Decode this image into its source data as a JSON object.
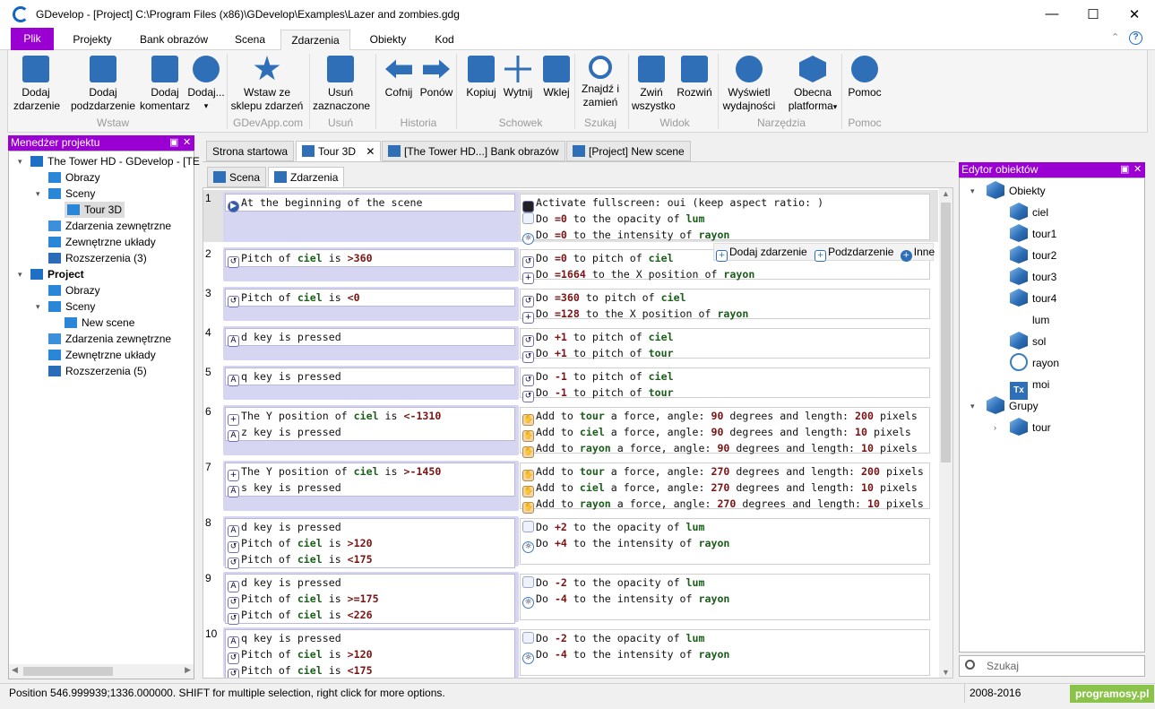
{
  "window": {
    "title": "GDevelop - [Project] C:\\Program Files (x86)\\GDevelop\\Examples\\Lazer and zombies.gdg"
  },
  "window_controls": {
    "min": "—",
    "max": "☐",
    "close": "✕"
  },
  "ribbon_tabs": [
    "Plik",
    "Projekty",
    "Bank obrazów",
    "Scena",
    "Zdarzenia",
    "Obiekty",
    "Kod"
  ],
  "ribbon_right": {
    "collapse": "⌃",
    "help": "?"
  },
  "ribbon": {
    "buttons": [
      {
        "label": "Dodaj\nzdarzenie",
        "icon": "add-event-icon"
      },
      {
        "label": "Dodaj\npodzdarzenie",
        "icon": "add-subevent-icon"
      },
      {
        "label": "Dodaj\nkomentarz",
        "icon": "add-comment-icon"
      },
      {
        "label": "Dodaj...",
        "icon": "add-more-icon"
      },
      {
        "label": "Wstaw ze\nsklepu zdarzeń",
        "icon": "event-store-icon"
      },
      {
        "label": "Usuń\nzaznaczone",
        "icon": "delete-selected-icon"
      },
      {
        "label": "Cofnij",
        "icon": "undo-icon"
      },
      {
        "label": "Ponów",
        "icon": "redo-icon"
      },
      {
        "label": "Kopiuj",
        "icon": "copy-icon"
      },
      {
        "label": "Wytnij",
        "icon": "cut-icon"
      },
      {
        "label": "Wklej",
        "icon": "paste-icon"
      },
      {
        "label": "Znajdź i\nzamień",
        "icon": "search-icon"
      },
      {
        "label": "Zwiń\nwszystko",
        "icon": "collapse-all-icon"
      },
      {
        "label": "Rozwiń",
        "icon": "expand-icon"
      },
      {
        "label": "Wyświetl\nwydajności",
        "icon": "profiler-icon"
      },
      {
        "label": "Obecna\nplatforma",
        "icon": "platform-icon"
      },
      {
        "label": "Pomoc",
        "icon": "help-icon"
      }
    ],
    "groups": [
      "Wstaw",
      "GDevApp.com",
      "Usuń",
      "Historia",
      "Schowek",
      "Szukaj",
      "Widok",
      "Narzędzia",
      "Pomoc"
    ],
    "dropdown_caret": "▾"
  },
  "project_manager": {
    "title": "Menedżer projektu",
    "items": [
      {
        "label": "The Tower HD - GDevelop - [TE",
        "level": 0,
        "expander": "▾",
        "icon": "project-icon",
        "bold": false
      },
      {
        "label": "Obrazy",
        "level": 1,
        "expander": "",
        "icon": "images-icon",
        "bold": false
      },
      {
        "label": "Sceny",
        "level": 1,
        "expander": "▾",
        "icon": "scenes-icon",
        "bold": false
      },
      {
        "label": "Tour 3D",
        "level": 2,
        "expander": "",
        "icon": "scene-icon",
        "bold": false,
        "selected": true
      },
      {
        "label": "Zdarzenia zewnętrzne",
        "level": 1,
        "expander": "",
        "icon": "external-events-icon",
        "bold": false
      },
      {
        "label": "Zewnętrzne układy",
        "level": 1,
        "expander": "",
        "icon": "external-layouts-icon",
        "bold": false
      },
      {
        "label": "Rozszerzenia (3)",
        "level": 1,
        "expander": "",
        "icon": "extensions-icon",
        "bold": false
      },
      {
        "label": "Project",
        "level": 0,
        "expander": "▾",
        "icon": "project-icon",
        "bold": true
      },
      {
        "label": "Obrazy",
        "level": 1,
        "expander": "",
        "icon": "images-icon",
        "bold": false
      },
      {
        "label": "Sceny",
        "level": 1,
        "expander": "▾",
        "icon": "scenes-icon",
        "bold": false
      },
      {
        "label": "New scene",
        "level": 2,
        "expander": "",
        "icon": "scene-icon",
        "bold": false
      },
      {
        "label": "Zdarzenia zewnętrzne",
        "level": 1,
        "expander": "",
        "icon": "external-events-icon",
        "bold": false
      },
      {
        "label": "Zewnętrzne układy",
        "level": 1,
        "expander": "",
        "icon": "external-layouts-icon",
        "bold": false
      },
      {
        "label": "Rozszerzenia (5)",
        "level": 1,
        "expander": "",
        "icon": "extensions-icon",
        "bold": false
      }
    ]
  },
  "doc_tabs": [
    {
      "label": "Strona startowa",
      "close": ""
    },
    {
      "label": "Tour 3D",
      "close": "✕"
    },
    {
      "label": "[The Tower HD...] Bank obrazów",
      "close": ""
    },
    {
      "label": "[Project] New scene",
      "close": ""
    }
  ],
  "sub_tabs": [
    "Scena",
    "Zdarzenia"
  ],
  "event_toolbar": {
    "add_event": "Dodaj zdarzenie",
    "add_subevent": "Podzdarzenie",
    "more": "Inne"
  },
  "events": [
    {
      "num": "1",
      "conditions": [
        {
          "icon": "scene-start-icon",
          "html": "At the beginning of the scene"
        }
      ],
      "actions": [
        {
          "icon": "fullscreen-icon",
          "html": "Activate fullscreen: oui (keep aspect ratio: )"
        },
        {
          "icon": "opacity-icon",
          "html": "Do <b>=0</b> to the opacity of <i>lum</i>"
        },
        {
          "icon": "light-icon",
          "html": "Do <b>=0</b> to the intensity of <i>rayon</i>"
        }
      ]
    },
    {
      "num": "2",
      "conditions": [
        {
          "icon": "pitch-icon",
          "html": "Pitch of <i>ciel</i> is <b>&gt;360</b>"
        }
      ],
      "actions": [
        {
          "icon": "pitch-icon",
          "html": "Do <b>=0</b> to pitch of <i>ciel</i>"
        },
        {
          "icon": "position-icon",
          "html": "Do <b>=1664</b> to the X position of <i>rayon</i>"
        }
      ]
    },
    {
      "num": "3",
      "conditions": [
        {
          "icon": "pitch-icon",
          "html": "Pitch of <i>ciel</i> is <b>&lt;0</b>"
        }
      ],
      "actions": [
        {
          "icon": "pitch-icon",
          "html": "Do <b>=360</b> to pitch of <i>ciel</i>"
        },
        {
          "icon": "position-icon",
          "html": "Do <b>=128</b> to the X position of <i>rayon</i>"
        }
      ]
    },
    {
      "num": "4",
      "conditions": [
        {
          "icon": "key-icon",
          "html": "d key is pressed"
        }
      ],
      "actions": [
        {
          "icon": "pitch-icon",
          "html": "Do <b>+1</b> to pitch of <i>ciel</i>"
        },
        {
          "icon": "pitch-icon",
          "html": "Do <b>+1</b> to pitch of <i>tour</i>"
        }
      ]
    },
    {
      "num": "5",
      "conditions": [
        {
          "icon": "key-icon",
          "html": "q key is pressed"
        }
      ],
      "actions": [
        {
          "icon": "pitch-icon",
          "html": "Do <b>-1</b> to pitch of <i>ciel</i>"
        },
        {
          "icon": "pitch-icon",
          "html": "Do <b>-1</b> to pitch of <i>tour</i>"
        }
      ]
    },
    {
      "num": "6",
      "conditions": [
        {
          "icon": "position-icon",
          "html": "The Y position of <i>ciel</i> is <b>&lt;-1310</b>"
        },
        {
          "icon": "key-icon",
          "html": "z key is pressed"
        }
      ],
      "actions": [
        {
          "icon": "force-icon",
          "html": "Add to <i>tour</i> a force, angle: <b>90</b> degrees and length: <b>200</b> pixels"
        },
        {
          "icon": "force-icon",
          "html": "Add to <i>ciel</i> a force, angle: <b>90</b> degrees and length: <b>10</b> pixels"
        },
        {
          "icon": "force-icon",
          "html": "Add to <i>rayon</i> a force, angle: <b>90</b> degrees and length: <b>10</b> pixels"
        }
      ]
    },
    {
      "num": "7",
      "conditions": [
        {
          "icon": "position-icon",
          "html": "The Y position of <i>ciel</i> is <b>&gt;-1450</b>"
        },
        {
          "icon": "key-icon",
          "html": "s key is pressed"
        }
      ],
      "actions": [
        {
          "icon": "force-icon",
          "html": "Add to <i>tour</i> a force, angle: <b>270</b> degrees and length: <b>200</b> pixels"
        },
        {
          "icon": "force-icon",
          "html": "Add to <i>ciel</i> a force, angle: <b>270</b> degrees and length: <b>10</b> pixels"
        },
        {
          "icon": "force-icon",
          "html": "Add to <i>rayon</i> a force, angle: <b>270</b> degrees and length: <b>10</b> pixels"
        }
      ]
    },
    {
      "num": "8",
      "conditions": [
        {
          "icon": "key-icon",
          "html": "d key is pressed"
        },
        {
          "icon": "pitch-icon",
          "html": "Pitch of <i>ciel</i> is <b>&gt;120</b>"
        },
        {
          "icon": "pitch-icon",
          "html": "Pitch of <i>ciel</i> is <b>&lt;175</b>"
        }
      ],
      "actions": [
        {
          "icon": "opacity-icon",
          "html": "Do <b>+2</b> to the opacity of <i>lum</i>"
        },
        {
          "icon": "light-icon",
          "html": "Do <b>+4</b> to the intensity of <i>rayon</i>"
        }
      ]
    },
    {
      "num": "9",
      "conditions": [
        {
          "icon": "key-icon",
          "html": "d key is pressed"
        },
        {
          "icon": "pitch-icon",
          "html": "Pitch of <i>ciel</i> is <b>&gt;=175</b>"
        },
        {
          "icon": "pitch-icon",
          "html": "Pitch of <i>ciel</i> is <b>&lt;226</b>"
        }
      ],
      "actions": [
        {
          "icon": "opacity-icon",
          "html": "Do <b>-2</b> to the opacity of <i>lum</i>"
        },
        {
          "icon": "light-icon",
          "html": "Do <b>-4</b> to the intensity of <i>rayon</i>"
        }
      ]
    },
    {
      "num": "10",
      "conditions": [
        {
          "icon": "key-icon",
          "html": "q key is pressed"
        },
        {
          "icon": "pitch-icon",
          "html": "Pitch of <i>ciel</i> is <b>&gt;120</b>"
        },
        {
          "icon": "pitch-icon",
          "html": "Pitch of <i>ciel</i> is <b>&lt;175</b>"
        }
      ],
      "actions": [
        {
          "icon": "opacity-icon",
          "html": "Do <b>-2</b> to the opacity of <i>lum</i>"
        },
        {
          "icon": "light-icon",
          "html": "Do <b>-4</b> to the intensity of <i>rayon</i>"
        }
      ]
    }
  ],
  "object_editor": {
    "title": "Edytor obiektów",
    "items": [
      {
        "label": "Obiekty",
        "level": 0,
        "expander": "▾",
        "icon": "objects-group-icon"
      },
      {
        "label": "ciel",
        "level": 1,
        "expander": "",
        "icon": "box3d-icon"
      },
      {
        "label": "tour1",
        "level": 1,
        "expander": "",
        "icon": "box3d-icon"
      },
      {
        "label": "tour2",
        "level": 1,
        "expander": "",
        "icon": "box3d-icon"
      },
      {
        "label": "tour3",
        "level": 1,
        "expander": "",
        "icon": "box3d-icon"
      },
      {
        "label": "tour4",
        "level": 1,
        "expander": "",
        "icon": "box3d-icon"
      },
      {
        "label": "lum",
        "level": 1,
        "expander": "",
        "icon": "blank-icon"
      },
      {
        "label": "sol",
        "level": 1,
        "expander": "",
        "icon": "box3d-icon"
      },
      {
        "label": "rayon",
        "level": 1,
        "expander": "",
        "icon": "light-object-icon"
      },
      {
        "label": "moi",
        "level": 1,
        "expander": "",
        "icon": "text-object-icon"
      },
      {
        "label": "Grupy",
        "level": 0,
        "expander": "▾",
        "icon": "groups-icon"
      },
      {
        "label": "tour",
        "level": 1,
        "expander": "›",
        "icon": "group-item-icon"
      }
    ],
    "search_placeholder": "Szukaj"
  },
  "status": {
    "text": "Position 546.999939;1336.000000. SHIFT for multiple selection, right click for more options.",
    "years": "2008-2016",
    "watermark": "programosy.pl"
  },
  "colors": {
    "accent": "#9b00d3",
    "cond_bg": "#d6d6f2",
    "param": "#7a1414",
    "object": "#1a5e1a"
  }
}
